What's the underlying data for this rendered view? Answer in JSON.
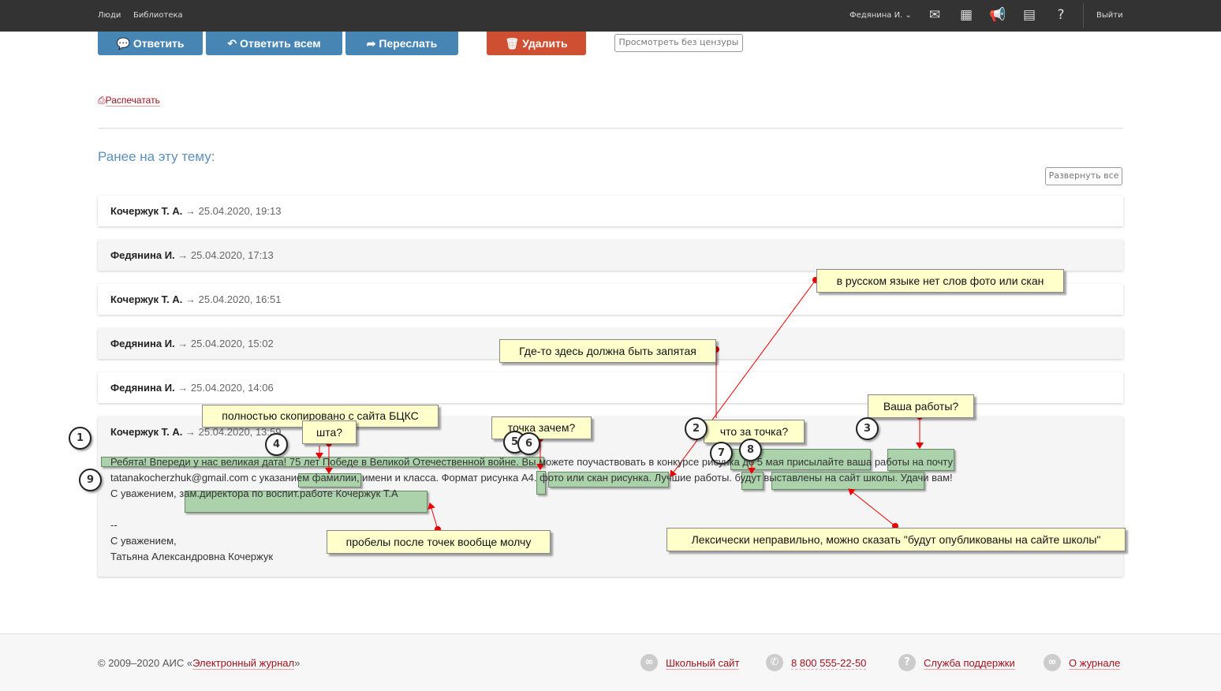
{
  "nav": {
    "people": "Люди",
    "library": "Библиотека",
    "user": "Федянина И.",
    "logout": "Выйти"
  },
  "toolbar": {
    "reply": "Ответить",
    "reply_all": "Ответить всем",
    "forward": "Переслать",
    "delete": "Удалить",
    "uncensored": "Просмотреть без цензуры",
    "print": "Распечатать"
  },
  "thread": {
    "title": "Ранее на эту тему:",
    "expand": "Развернуть все",
    "items": [
      {
        "author": "Кочержук Т. А.",
        "date": "→ 25.04.2020, 19:13"
      },
      {
        "author": "Федянина И.",
        "date": "→ 25.04.2020, 17:13"
      },
      {
        "author": "Кочержук Т. А.",
        "date": "→ 25.04.2020, 16:51"
      },
      {
        "author": "Федянина И.",
        "date": "→ 25.04.2020, 15:02"
      },
      {
        "author": "Федянина И.",
        "date": "→ 25.04.2020, 14:06"
      }
    ],
    "open": {
      "author": "Кочержук Т. А.",
      "date": "→ 25.04.2020, 13:59",
      "lines": [
        "Ребята! Впереди у нас великая дата! 75 лет Победе в Великой Отечественной войне. Вы можете поучаствовать в конкурсе рисунка до 5 мая присылайте ваша работы на почту",
        "tatanakocherzhuk@gmail.com с указанием фамилии, имени и класса. Формат рисунка А4. фото или скан рисунка. Лучшие работы. будут выставлены на сайт школы. Удачи вам!",
        "С уважением, зам.директора по воспит.работе Кочержук Т.А",
        "--",
        "С уважением,",
        "Татьяна Александровна Кочержук"
      ]
    }
  },
  "annotations": {
    "notes": [
      "в русском языке нет слов фото или скан",
      "Где-то здесь должна быть запятая",
      "полностью скопировано с сайта БЦКС",
      "шта?",
      "точка зачем?",
      "что за точка?",
      "Ваша работы?",
      "пробелы после точек вообще молчу",
      "Лексически неправильно, можно сказать \"будут опубликованы на сайте школы\""
    ],
    "numbers": [
      "1",
      "2",
      "3",
      "4",
      "5",
      "6",
      "7",
      "8",
      "9"
    ]
  },
  "footer": {
    "copyright": "© 2009–2020 АИС «",
    "journal": "Электронный журнал",
    "close": "»",
    "links": [
      "Школьный сайт",
      "8 800 555-22-50",
      "Служба поддержки",
      "О журнале"
    ]
  }
}
